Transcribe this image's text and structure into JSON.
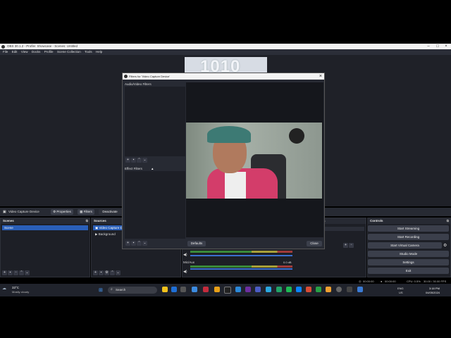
{
  "window": {
    "title": "OBS 30.1.2 - Profile: Showcase - Scenes: Untitled",
    "icons": [
      "minimize-icon",
      "maximize-icon",
      "close-icon"
    ]
  },
  "menu": [
    "File",
    "Edit",
    "View",
    "Docks",
    "Profile",
    "Scene Collection",
    "Tools",
    "Help"
  ],
  "sourcebar": {
    "source_name": "Video Capture Device",
    "properties": "Properties",
    "filters": "Filters",
    "deactivate": "Deactivate"
  },
  "scenes": {
    "header": "Scenes",
    "items": [
      "Scene"
    ]
  },
  "sources": {
    "header": "Sources",
    "items": [
      "Video Capture De",
      "Background"
    ]
  },
  "mixer": {
    "header": "s",
    "track": "Mic/Aux",
    "db": "0.0 dB"
  },
  "controls": {
    "header": "Controls",
    "buttons": [
      "Start Streaming",
      "Start Recording",
      "Start Virtual Camera",
      "Studio Mode",
      "Settings",
      "Exit"
    ]
  },
  "status": {
    "rec": "00:00:00",
    "stream": "00:00:00",
    "cpu": "CPU: 0.5%",
    "fps": "30.00 / 30.00 FPS"
  },
  "dialog": {
    "title": "Filters for 'Video Capture Device'",
    "av_filters": "Audio/Video Filters",
    "effect_filters": "Effect Filters",
    "defaults": "Defaults",
    "close": "Close"
  },
  "preview_text": "1010",
  "taskbar": {
    "weather_temp": "33°C",
    "weather_desc": "Mostly cloudy",
    "search": "Search",
    "lang": "ENG",
    "lang2": "US",
    "time": "3:18 PM",
    "date": "04/05/2024"
  }
}
